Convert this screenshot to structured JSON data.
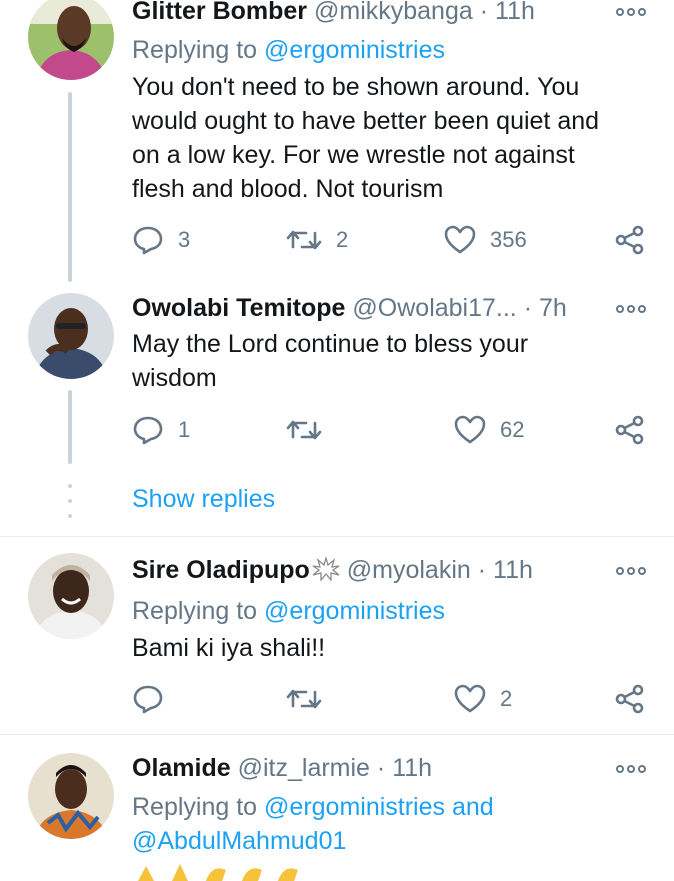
{
  "tweets": [
    {
      "name": "Glitter Bomber",
      "handle": "@mikkybanga",
      "separator": "·",
      "time": "11h",
      "replying_prefix": "Replying to",
      "replying_to": "@ergoministries",
      "body_lines": [
        "You don't need to be shown around. You",
        "would ought to have better been quiet and",
        "on a low key.  For we wrestle not against",
        "flesh and blood. Not tourism"
      ],
      "replies": "3",
      "retweets": "2",
      "likes": "356"
    },
    {
      "name": "Owolabi Temitope",
      "handle": "@Owolabi17...",
      "separator": "·",
      "time": "7h",
      "body_lines": [
        "May the Lord  continue to bless your",
        "wisdom"
      ],
      "replies": "1",
      "retweets": "",
      "likes": "62"
    },
    {
      "name": "Sire Oladipupo",
      "handle": "@myolakin",
      "separator": "·",
      "time": "11h",
      "replying_prefix": "Replying to",
      "replying_to": "@ergoministries",
      "body_lines": [
        "Bami ki iya shali!!"
      ],
      "replies": "",
      "retweets": "",
      "likes": "2"
    },
    {
      "name": "Olamide",
      "handle": "@itz_larmie",
      "separator": "·",
      "time": "11h",
      "replying_prefix": "Replying to",
      "replying_to": "@ergoministries and",
      "replying_to_2": "@AbdulMahmud01"
    }
  ],
  "show_replies": "Show replies",
  "icons": {
    "reply": "reply-icon",
    "retweet": "retweet-icon",
    "like": "heart-icon",
    "share": "share-icon",
    "more": "more-options-icon",
    "badge": "burst-icon"
  },
  "colors": {
    "accent": "#1da1f2",
    "secondary_text": "#657786",
    "primary_text": "#14171a",
    "divider": "#e6ecf0"
  }
}
